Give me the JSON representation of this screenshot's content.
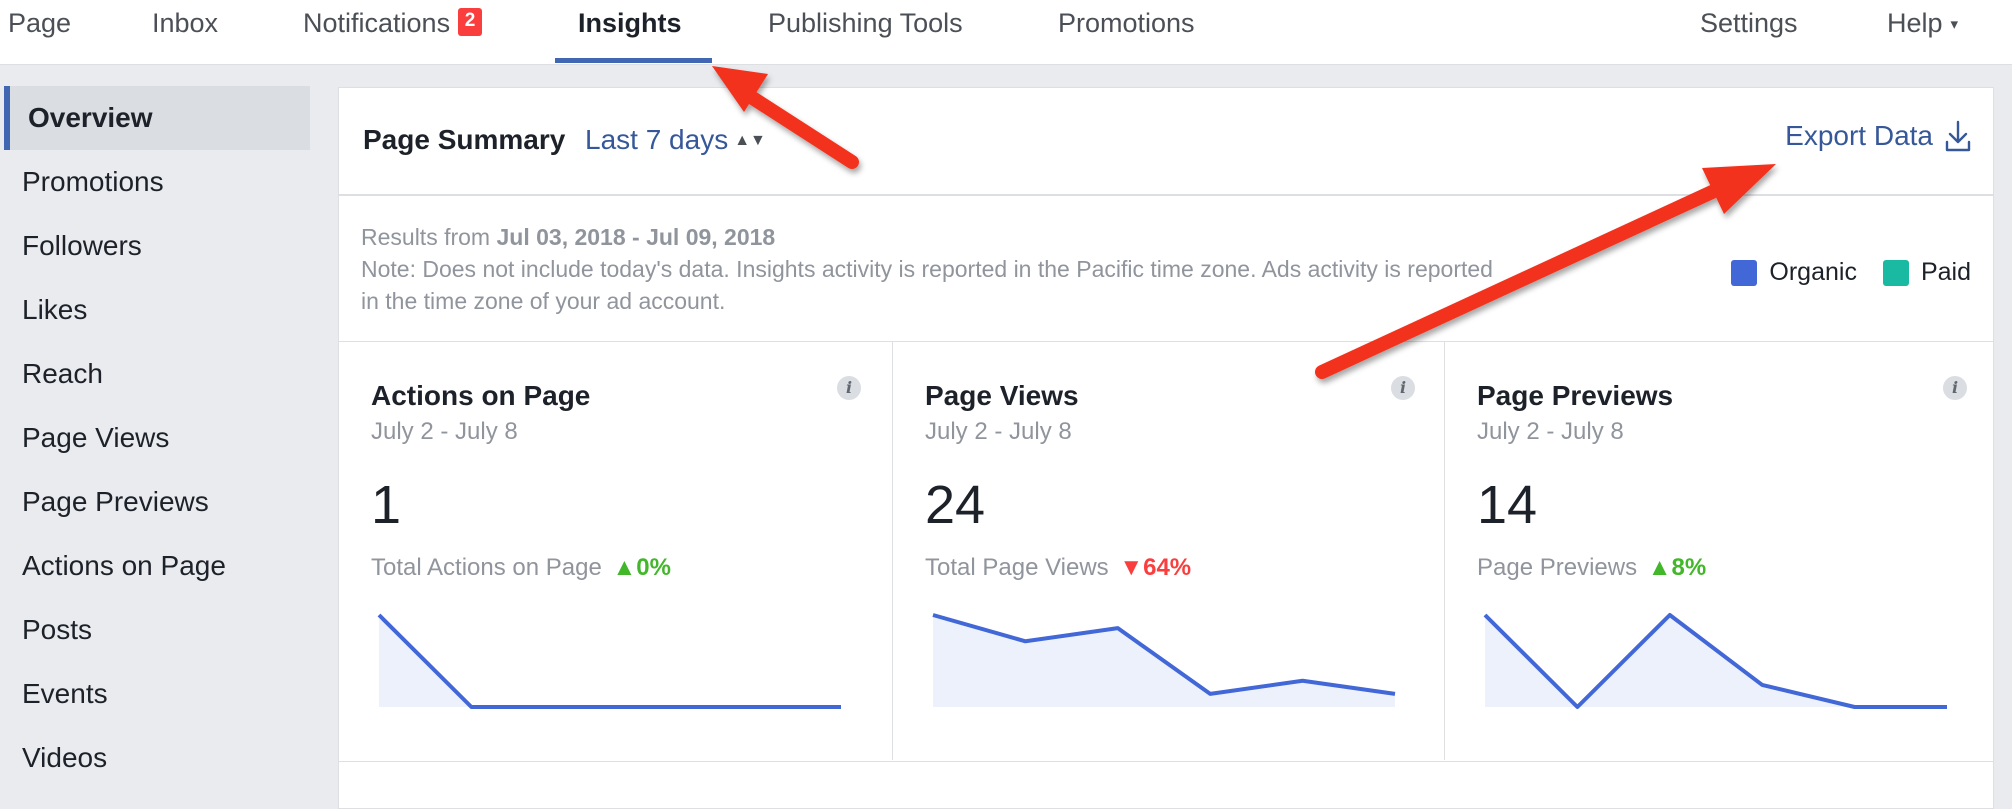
{
  "topnav": {
    "items": [
      {
        "label": "Page"
      },
      {
        "label": "Inbox"
      },
      {
        "label": "Notifications",
        "badge": "2"
      },
      {
        "label": "Insights"
      },
      {
        "label": "Publishing Tools"
      },
      {
        "label": "Promotions"
      },
      {
        "label": "Settings"
      },
      {
        "label": "Help"
      }
    ],
    "active": "Insights"
  },
  "sidebar": {
    "items": [
      {
        "label": "Overview"
      },
      {
        "label": "Promotions"
      },
      {
        "label": "Followers"
      },
      {
        "label": "Likes"
      },
      {
        "label": "Reach"
      },
      {
        "label": "Page Views"
      },
      {
        "label": "Page Previews"
      },
      {
        "label": "Actions on Page"
      },
      {
        "label": "Posts"
      },
      {
        "label": "Events"
      },
      {
        "label": "Videos"
      }
    ],
    "active": "Overview"
  },
  "summary": {
    "title": "Page Summary",
    "range": "Last 7 days",
    "export_label": "Export Data",
    "results_prefix": "Results from",
    "results_range": "Jul 03, 2018 - Jul 09, 2018",
    "note_line1": "Note: Does not include today's data. Insights activity is reported in the Pacific time zone. Ads activity is reported",
    "note_line2": "in the time zone of your ad account."
  },
  "legend": [
    {
      "label": "Organic",
      "color": "#4267d7"
    },
    {
      "label": "Paid",
      "color": "#1ab9a2"
    }
  ],
  "metrics": [
    {
      "title": "Actions on Page",
      "date": "July 2 - July 8",
      "value": "1",
      "sub_label": "Total Actions on Page",
      "change": "0%",
      "direction": "up",
      "series": [
        1,
        0,
        0,
        0,
        0,
        0
      ]
    },
    {
      "title": "Page Views",
      "date": "July 2 - July 8",
      "value": "24",
      "sub_label": "Total Page Views",
      "change": "64%",
      "direction": "down",
      "series": [
        7,
        5,
        6,
        1,
        2,
        1
      ]
    },
    {
      "title": "Page Previews",
      "date": "July 2 - July 8",
      "value": "14",
      "sub_label": "Page Previews",
      "change": "8%",
      "direction": "up",
      "series": [
        5,
        0,
        5,
        1.2,
        0,
        0
      ]
    }
  ],
  "colors": {
    "accent": "#4267b2",
    "link": "#365899",
    "spark_line": "#4267d7",
    "spark_fill": "#edf1fb",
    "up": "#42b72a",
    "down": "#fa3e3e",
    "annotation_arrow": "#f2311d"
  }
}
